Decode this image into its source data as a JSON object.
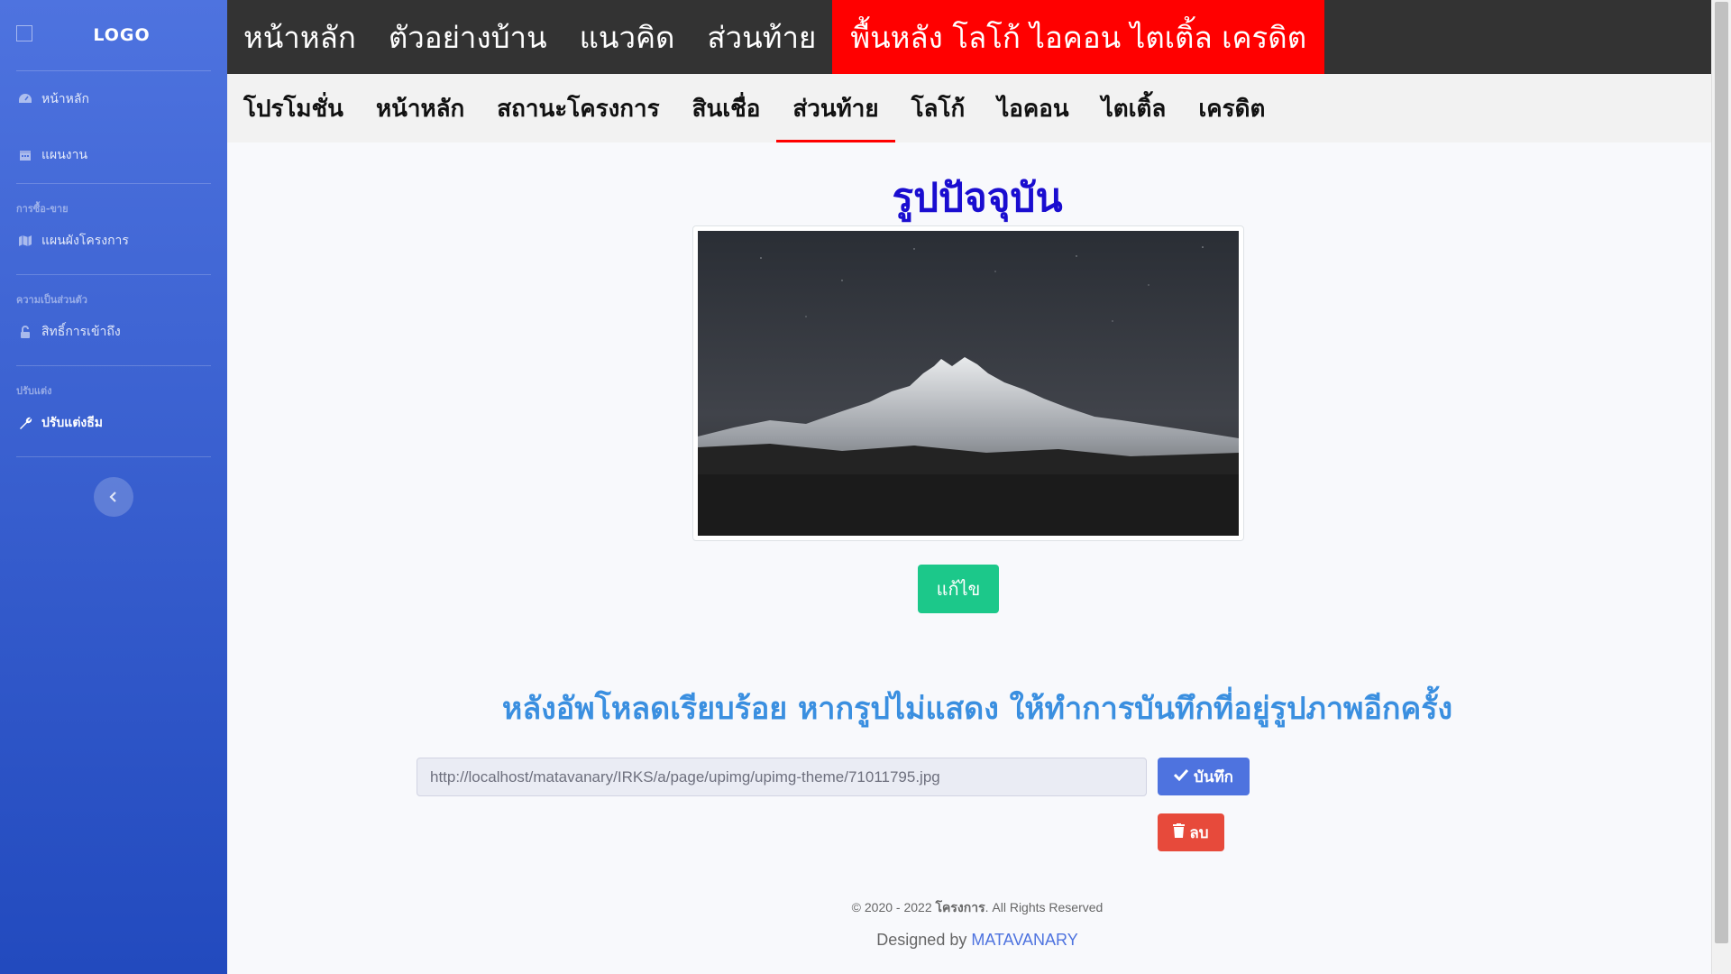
{
  "sidebar": {
    "logo_text": "LOGO",
    "items": [
      {
        "label": "หน้าหลัก",
        "icon": "dashboard-icon"
      },
      {
        "label": "แผนงาน",
        "icon": "calendar-icon"
      }
    ],
    "sections": [
      {
        "heading": "การซื้อ-ขาย",
        "items": [
          {
            "label": "แผนผังโครงการ",
            "icon": "map-icon"
          }
        ]
      },
      {
        "heading": "ความเป็นส่วนตัว",
        "items": [
          {
            "label": "สิทธิ์การเข้าถึง",
            "icon": "unlock-icon"
          }
        ]
      },
      {
        "heading": "ปรับแต่ง",
        "items": [
          {
            "label": "ปรับแต่งธีม",
            "icon": "wrench-icon",
            "active": true
          }
        ]
      }
    ],
    "toggle_icon": "chevron-left-icon"
  },
  "topbar": {
    "items": [
      "หน้าหลัก",
      "ตัวอย่างบ้าน",
      "แนวคิด",
      "ส่วนท้าย",
      "พื้นหลัง โลโก้ ไอคอน ไตเติ้ล เครดิต"
    ],
    "active_index": 4,
    "active_color": "#ff0000"
  },
  "subnav": {
    "items": [
      "โปรโมชั่น",
      "หน้าหลัก",
      "สถานะโครงการ",
      "สินเชื่อ",
      "ส่วนท้าย",
      "โลโก้",
      "ไอคอน",
      "ไตเติ้ล",
      "เครดิต"
    ],
    "active_index": 4
  },
  "main": {
    "title": "รูปปัจจุบัน",
    "edit_label": "แก้ไข",
    "notice": "หลังอัพโหลดเรียบร้อย หากรูปไม่แสดง ให้ทำการบันทึกที่อยู่รูปภาพอีกครั้ง",
    "url_value": "http://localhost/matavanary/IRKS/a/page/upimg/upimg-theme/71011795.jpg",
    "save_label": "บันทึก",
    "delete_label": "ลบ"
  },
  "footer": {
    "copyright_prefix": "© 2020 - 2022 ",
    "copyright_name": "โครงการ",
    "copyright_suffix": ". All Rights Reserved",
    "designed_prefix": "Designed by ",
    "designed_link": "MATAVANARY"
  },
  "colors": {
    "sidebar_top": "#4e73df",
    "sidebar_bottom": "#224abe",
    "title": "#1a0dd0",
    "notice": "#3a8fe0",
    "edit_button": "#1cc88a",
    "save_button": "#4e73df",
    "delete_button": "#e74a3b"
  }
}
